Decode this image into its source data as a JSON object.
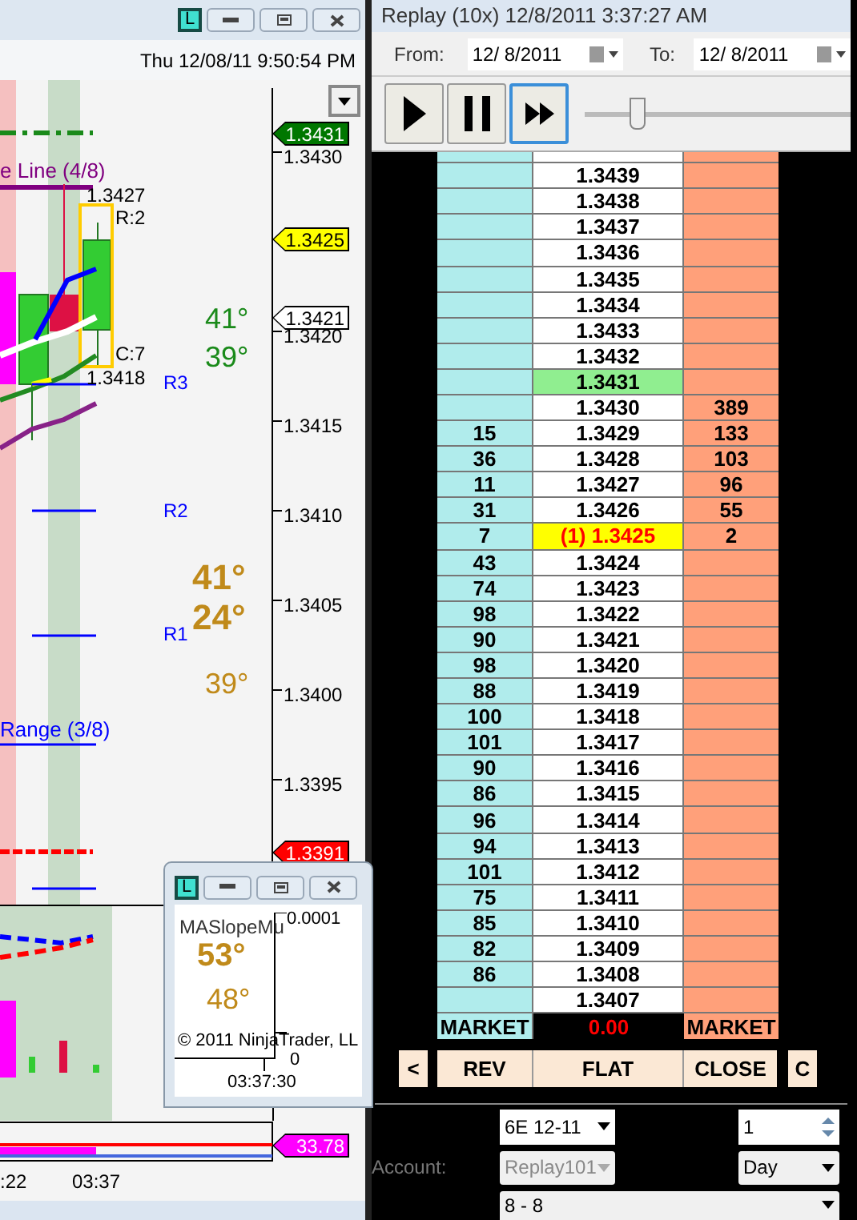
{
  "chart_window": {
    "badge": "L",
    "timestamp": "Thu 12/08/11 9:50:54 PM",
    "annotations": [
      {
        "text": "e Line (4/8)",
        "color": "#800080",
        "bold": false
      },
      {
        "text": "1.3427",
        "color": "#000000",
        "bold": false
      },
      {
        "text": "R:2",
        "color": "#000000",
        "bold": false
      },
      {
        "text": "C:7",
        "color": "#000000",
        "bold": false
      },
      {
        "text": "1.3418",
        "color": "#000000",
        "bold": false
      },
      {
        "text": "R3",
        "color": "#0000ff",
        "bold": false
      },
      {
        "text": "41°",
        "color": "#1a8a1a",
        "bold": false
      },
      {
        "text": "39°",
        "color": "#1a8a1a",
        "bold": false
      },
      {
        "text": "R2",
        "color": "#0000ff",
        "bold": false
      },
      {
        "text": "41°",
        "color": "#c08a1a",
        "bold": true
      },
      {
        "text": "24°",
        "color": "#c08a1a",
        "bold": true
      },
      {
        "text": "R1",
        "color": "#0000ff",
        "bold": false
      },
      {
        "text": "39°",
        "color": "#c08a1a",
        "bold": false
      },
      {
        "text": "Range (3/8)",
        "color": "#0000ff",
        "bold": false
      }
    ],
    "axis_labels": [
      "1.3430",
      "1.3420",
      "1.3415",
      "1.3410",
      "1.3405",
      "1.3400",
      "1.3395"
    ],
    "price_tags": [
      {
        "text": "1.3431",
        "color": "#007700"
      },
      {
        "text": "1.3425",
        "color": "#ffff00"
      },
      {
        "text": "1.3421",
        "color": "#ffffff"
      },
      {
        "text": "1.3391",
        "color": "#ff0000"
      }
    ],
    "lower_tag": {
      "text": "33.78",
      "color": "#ff00ff"
    },
    "time_labels": [
      ":22",
      "03:37"
    ]
  },
  "mini_window": {
    "badge": "L",
    "title": "MASlopeMu",
    "axis_value": "0.0001",
    "readings": [
      "53°",
      "48°"
    ],
    "copyright": "© 2011 NinjaTrader, LL",
    "axis_zero": "0",
    "time": "03:37:30"
  },
  "replay": {
    "title": "Replay (10x) 12/8/2011 3:37:27 AM",
    "from_label": "From:",
    "from_date": "12/  8/2011",
    "to_label": "To:",
    "to_date": "12/  8/2011",
    "speed": {
      "level": 0.17
    }
  },
  "dom": {
    "rows": [
      {
        "bid": "",
        "price": "1.3439",
        "ask": "",
        "kind": "plain"
      },
      {
        "bid": "",
        "price": "1.3438",
        "ask": "",
        "kind": "plain"
      },
      {
        "bid": "",
        "price": "1.3437",
        "ask": "",
        "kind": "plain"
      },
      {
        "bid": "",
        "price": "1.3436",
        "ask": "",
        "kind": "plain"
      },
      {
        "bid": "",
        "price": "1.3435",
        "ask": "",
        "kind": "plain"
      },
      {
        "bid": "",
        "price": "1.3434",
        "ask": "",
        "kind": "plain"
      },
      {
        "bid": "",
        "price": "1.3433",
        "ask": "",
        "kind": "plain"
      },
      {
        "bid": "",
        "price": "1.3432",
        "ask": "",
        "kind": "plain"
      },
      {
        "bid": "",
        "price": "1.3431",
        "ask": "",
        "kind": "last"
      },
      {
        "bid": "",
        "price": "1.3430",
        "ask": "389",
        "kind": "plain"
      },
      {
        "bid": "15",
        "price": "1.3429",
        "ask": "133",
        "kind": "plain"
      },
      {
        "bid": "36",
        "price": "1.3428",
        "ask": "103",
        "kind": "plain"
      },
      {
        "bid": "11",
        "price": "1.3427",
        "ask": "96",
        "kind": "plain"
      },
      {
        "bid": "31",
        "price": "1.3426",
        "ask": "55",
        "kind": "plain"
      },
      {
        "bid": "7",
        "price": "(1) 1.3425",
        "ask": "2",
        "kind": "position"
      },
      {
        "bid": "43",
        "price": "1.3424",
        "ask": "",
        "kind": "plain"
      },
      {
        "bid": "74",
        "price": "1.3423",
        "ask": "",
        "kind": "plain"
      },
      {
        "bid": "98",
        "price": "1.3422",
        "ask": "",
        "kind": "plain"
      },
      {
        "bid": "90",
        "price": "1.3421",
        "ask": "",
        "kind": "plain"
      },
      {
        "bid": "98",
        "price": "1.3420",
        "ask": "",
        "kind": "plain"
      },
      {
        "bid": "88",
        "price": "1.3419",
        "ask": "",
        "kind": "plain"
      },
      {
        "bid": "100",
        "price": "1.3418",
        "ask": "",
        "kind": "plain"
      },
      {
        "bid": "101",
        "price": "1.3417",
        "ask": "",
        "kind": "plain"
      },
      {
        "bid": "90",
        "price": "1.3416",
        "ask": "",
        "kind": "plain"
      },
      {
        "bid": "86",
        "price": "1.3415",
        "ask": "",
        "kind": "plain"
      },
      {
        "bid": "96",
        "price": "1.3414",
        "ask": "",
        "kind": "plain"
      },
      {
        "bid": "94",
        "price": "1.3413",
        "ask": "",
        "kind": "plain"
      },
      {
        "bid": "101",
        "price": "1.3412",
        "ask": "",
        "kind": "plain"
      },
      {
        "bid": "75",
        "price": "1.3411",
        "ask": "",
        "kind": "plain"
      },
      {
        "bid": "85",
        "price": "1.3410",
        "ask": "",
        "kind": "plain"
      },
      {
        "bid": "82",
        "price": "1.3409",
        "ask": "",
        "kind": "plain"
      },
      {
        "bid": "86",
        "price": "1.3408",
        "ask": "",
        "kind": "plain"
      },
      {
        "bid": "",
        "price": "1.3407",
        "ask": "",
        "kind": "plain"
      }
    ],
    "market": {
      "bid": "MARKET",
      "pnl": "0.00",
      "ask": "MARKET"
    },
    "buttons": [
      "<",
      "REV",
      "FLAT",
      "CLOSE",
      "C"
    ]
  },
  "order_form": {
    "instrument": "6E 12-11",
    "quantity": "1",
    "account_label": "Account:",
    "account": "Replay101",
    "account_disabled": true,
    "tif": "Day",
    "strategy": "8 - 8"
  }
}
